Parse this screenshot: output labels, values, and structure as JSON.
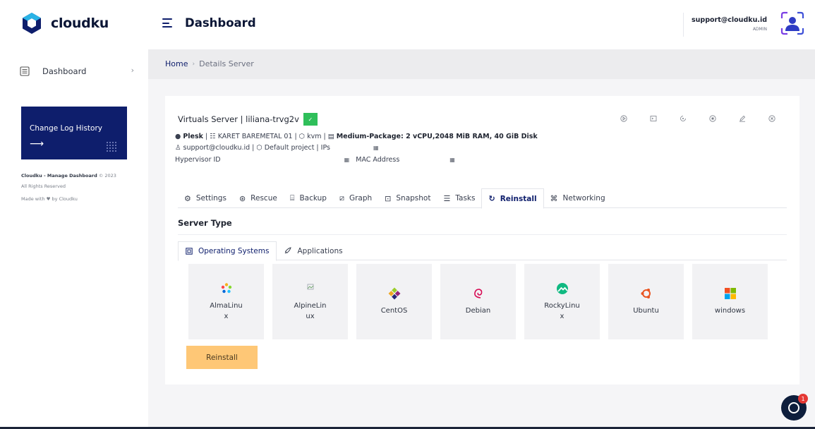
{
  "brand": {
    "name": "cloudku"
  },
  "sidebar": {
    "items": [
      {
        "label": "Dashboard"
      }
    ],
    "changelog": {
      "label": "Change Log History",
      "arrow": "⟶"
    },
    "footer": {
      "line1_bold": "Cloudku - Manage Dashboard",
      "line1_rest": " © 2023",
      "line2": "All Rights Reserved",
      "line3_pre": "Made with ",
      "line3_post": " by Cloudku"
    }
  },
  "header": {
    "title": "Dashboard",
    "user_email": "support@cloudku.id",
    "user_role": "ADMIN"
  },
  "breadcrumb": {
    "home": "Home",
    "separator": "›",
    "current": "Details Server"
  },
  "server": {
    "title": "Virtuals Server | liliana-trvg2v",
    "status_icon": "✓",
    "panel": "Plesk",
    "location": " | ☷ KARET BAREMETAL 01 | ",
    "virt": "⬡ kvm | ▤ ",
    "package": "Medium-Package: 2 vCPU,2048 MiB RAM, 40 GiB Disk",
    "owner_line": "♙ support@cloudku.id | ⬡ Default project | IPs",
    "hypervisor_label": "Hypervisor ID",
    "mac_label": "MAC Address"
  },
  "tabs": [
    {
      "label": "Settings",
      "icon": "⚙"
    },
    {
      "label": "Rescue",
      "icon": "⊛"
    },
    {
      "label": "Backup",
      "icon": "⌸"
    },
    {
      "label": "Graph",
      "icon": "⧄"
    },
    {
      "label": "Snapshot",
      "icon": "⊡"
    },
    {
      "label": "Tasks",
      "icon": "☰"
    },
    {
      "label": "Reinstall",
      "icon": "↻"
    },
    {
      "label": "Networking",
      "icon": "⌘"
    }
  ],
  "section": {
    "title": "Server Type"
  },
  "subtabs": [
    {
      "label": "Operating Systems"
    },
    {
      "label": "Applications"
    }
  ],
  "os_list": [
    {
      "name": "AlmaLinux"
    },
    {
      "name": "AlpineLinux"
    },
    {
      "name": "CentOS"
    },
    {
      "name": "Debian"
    },
    {
      "name": "RockyLinux"
    },
    {
      "name": "Ubuntu"
    },
    {
      "name": "windows"
    }
  ],
  "reinstall_button": "Reinstall",
  "chat": {
    "badge": "1"
  },
  "colors": {
    "primary": "#0e1e6c",
    "accent": "#fec776",
    "success": "#2fbf5a"
  }
}
